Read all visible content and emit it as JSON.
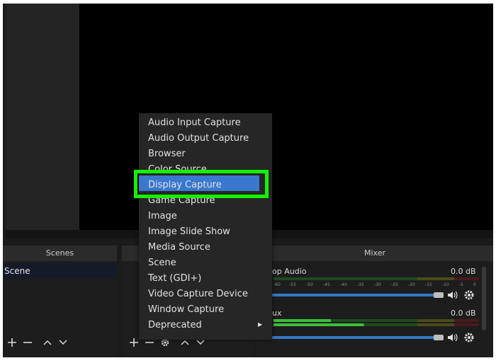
{
  "docks": {
    "scenes_title": "Scenes",
    "mixer_title": "Mixer"
  },
  "scenes": {
    "items": [
      "Scene"
    ]
  },
  "mixer": {
    "channels": [
      {
        "name": "op Audio",
        "db": "0.0 dB"
      },
      {
        "name": "ux",
        "db": "0.0 dB"
      }
    ],
    "scale": [
      "-60",
      "-55",
      "-50",
      "-45",
      "-40",
      "-35",
      "-30",
      "-25",
      "-20",
      "-15",
      "-10",
      "-5",
      "0"
    ]
  },
  "menu": {
    "items": [
      "Audio Input Capture",
      "Audio Output Capture",
      "Browser",
      "Color Source",
      "Display Capture",
      "Game Capture",
      "Image",
      "Image Slide Show",
      "Media Source",
      "Scene",
      "Text (GDI+)",
      "Video Capture Device",
      "Window Capture",
      "Deprecated"
    ],
    "selected": "Display Capture"
  },
  "colors": {
    "highlight_box": "#13f200",
    "selected_item": "#3a78cf",
    "fader": "#3478c8"
  },
  "icons": [
    "plus-icon",
    "minus-icon",
    "chevron-up-icon",
    "chevron-down-icon",
    "gear-icon",
    "speaker-icon",
    "chevron-right-icon"
  ]
}
